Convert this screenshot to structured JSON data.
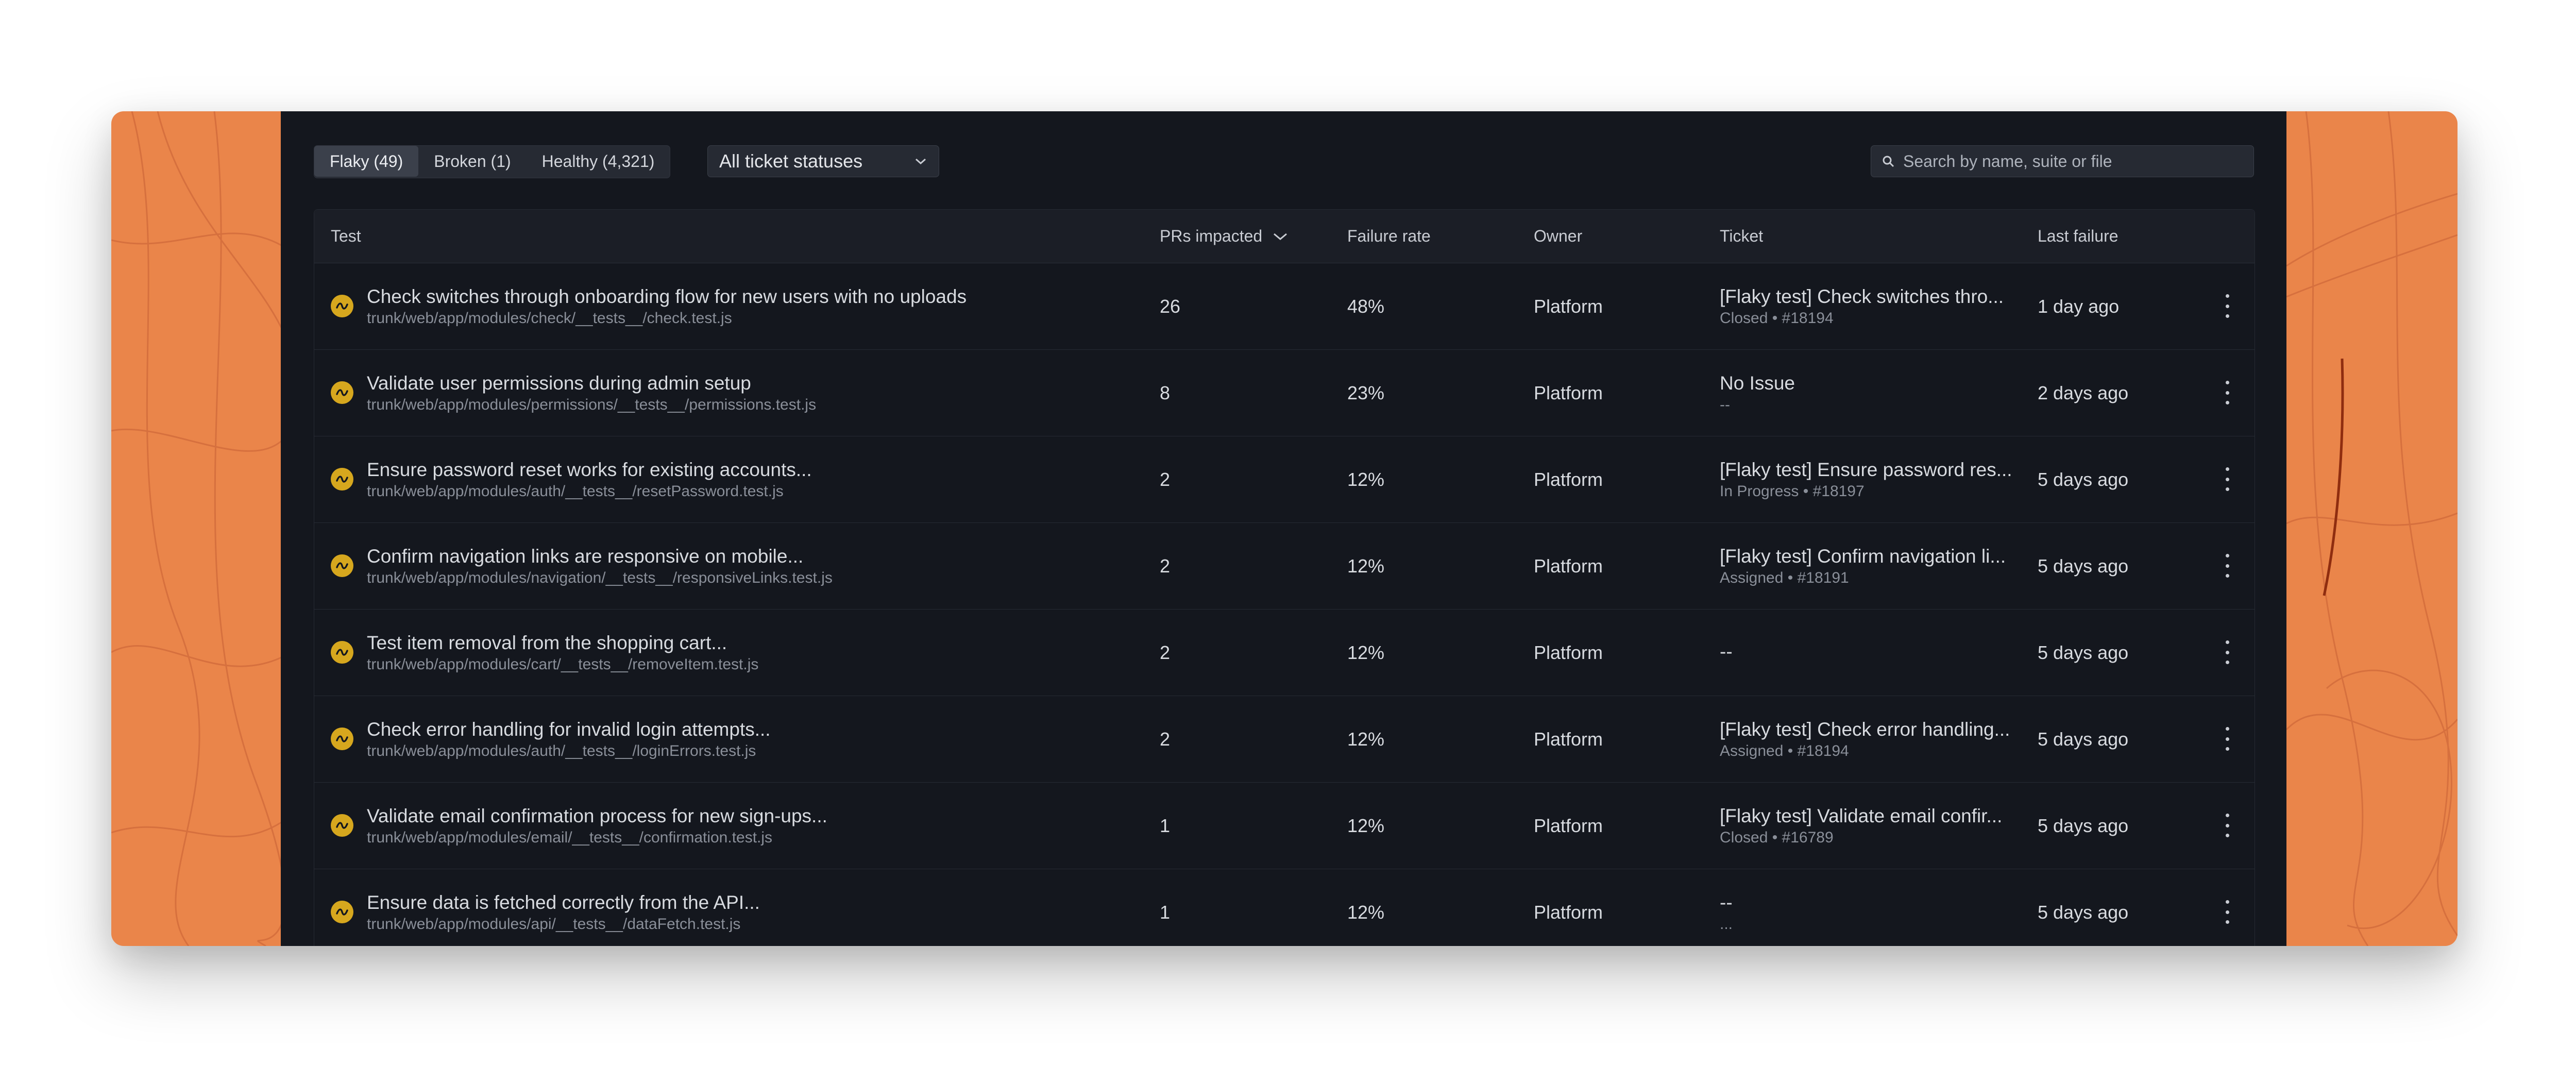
{
  "tabs": [
    {
      "label": "Flaky (49)",
      "active": true
    },
    {
      "label": "Broken (1)",
      "active": false
    },
    {
      "label": "Healthy (4,321)",
      "active": false
    }
  ],
  "status_filter": {
    "selected": "All ticket statuses",
    "icon": "chevron-down-icon"
  },
  "search": {
    "placeholder": "Search by name, suite or file",
    "value": "",
    "icon": "search-icon"
  },
  "columns": {
    "test": "Test",
    "prs_impacted": "PRs impacted",
    "failure_rate": "Failure rate",
    "owner": "Owner",
    "ticket": "Ticket",
    "last_failure": "Last failure"
  },
  "rows": [
    {
      "name": "Check switches through onboarding flow for new users with no uploads",
      "path": "trunk/web/app/modules/check/__tests__/check.test.js",
      "prs": "26",
      "rate": "48%",
      "owner": "Platform",
      "ticket": "[Flaky test] Check switches thro...",
      "ticket_meta": "Closed • #18194",
      "last": "1 day ago"
    },
    {
      "name": "Validate user permissions during admin setup",
      "path": "trunk/web/app/modules/permissions/__tests__/permissions.test.js",
      "prs": "8",
      "rate": "23%",
      "owner": "Platform",
      "ticket": "No Issue",
      "ticket_meta": "--",
      "last": "2 days ago"
    },
    {
      "name": "Ensure password reset works for existing accounts...",
      "path": "trunk/web/app/modules/auth/__tests__/resetPassword.test.js",
      "prs": "2",
      "rate": "12%",
      "owner": "Platform",
      "ticket": "[Flaky test] Ensure password res...",
      "ticket_meta": "In Progress • #18197",
      "last": "5 days ago"
    },
    {
      "name": "Confirm navigation links are responsive on mobile...",
      "path": "trunk/web/app/modules/navigation/__tests__/responsiveLinks.test.js",
      "prs": "2",
      "rate": "12%",
      "owner": "Platform",
      "ticket": "[Flaky test] Confirm navigation li...",
      "ticket_meta": "Assigned • #18191",
      "last": "5 days ago"
    },
    {
      "name": "Test item removal from the shopping cart...",
      "path": "trunk/web/app/modules/cart/__tests__/removeItem.test.js",
      "prs": "2",
      "rate": "12%",
      "owner": "Platform",
      "ticket": "--",
      "ticket_meta": "",
      "last": "5 days ago"
    },
    {
      "name": "Check error handling for invalid login attempts...",
      "path": "trunk/web/app/modules/auth/__tests__/loginErrors.test.js",
      "prs": "2",
      "rate": "12%",
      "owner": "Platform",
      "ticket": "[Flaky test] Check error handling...",
      "ticket_meta": "Assigned • #18194",
      "last": "5 days ago"
    },
    {
      "name": "Validate email confirmation process for new sign-ups...",
      "path": "trunk/web/app/modules/email/__tests__/confirmation.test.js",
      "prs": "1",
      "rate": "12%",
      "owner": "Platform",
      "ticket": "[Flaky test] Validate email confir...",
      "ticket_meta": "Closed •  #16789",
      "last": "5 days ago"
    },
    {
      "name": "Ensure data is fetched correctly from the API...",
      "path": "trunk/web/app/modules/api/__tests__/dataFetch.test.js",
      "prs": "1",
      "rate": "12%",
      "owner": "Platform",
      "ticket": "--",
      "ticket_meta": "...",
      "last": "5 days ago"
    }
  ],
  "colors": {
    "background_accent": "#ea854a",
    "panel": "#14171e",
    "flaky_icon": "#d6a71e"
  }
}
